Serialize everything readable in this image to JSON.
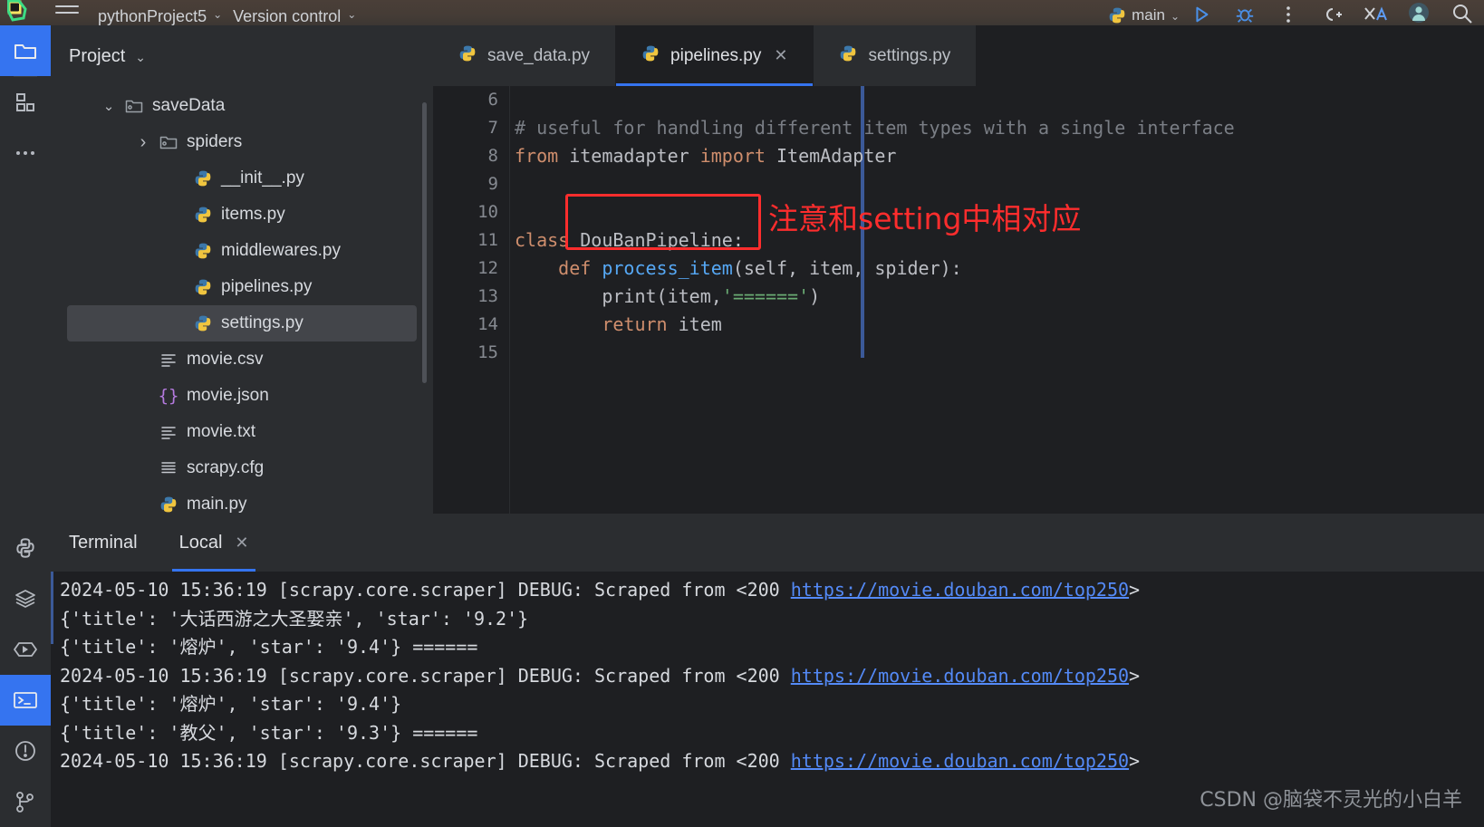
{
  "window": {
    "project_name": "pythonProject5",
    "version_control": "Version control",
    "run_config": "main"
  },
  "rail": {
    "items": [
      {
        "name": "project-folder",
        "icon": "folder-icon",
        "active": true
      },
      {
        "name": "structure",
        "icon": "structure-icon",
        "active": false
      },
      {
        "name": "more-tool-windows",
        "icon": "ellipsis-icon",
        "active": false
      },
      {
        "name": "python-packages",
        "icon": "python-icon",
        "active": false
      },
      {
        "name": "database",
        "icon": "layers-icon",
        "active": false
      },
      {
        "name": "run",
        "icon": "run-icon",
        "active": false
      },
      {
        "name": "terminal",
        "icon": "terminal-icon",
        "active": true
      },
      {
        "name": "problems",
        "icon": "warning-icon",
        "active": false
      },
      {
        "name": "version-control",
        "icon": "branch-icon",
        "active": false
      }
    ]
  },
  "project_panel": {
    "title": "Project",
    "tree": [
      {
        "label": "saveData",
        "icon": "folder-icon",
        "indent": 1,
        "arrow": "down",
        "selected": false
      },
      {
        "label": "spiders",
        "icon": "folder-icon",
        "indent": 2,
        "arrow": "right",
        "selected": false
      },
      {
        "label": "__init__.py",
        "icon": "python-icon",
        "indent": 3,
        "arrow": "none",
        "selected": false
      },
      {
        "label": "items.py",
        "icon": "python-icon",
        "indent": 3,
        "arrow": "none",
        "selected": false
      },
      {
        "label": "middlewares.py",
        "icon": "python-icon",
        "indent": 3,
        "arrow": "none",
        "selected": false
      },
      {
        "label": "pipelines.py",
        "icon": "python-icon",
        "indent": 3,
        "arrow": "none",
        "selected": false
      },
      {
        "label": "settings.py",
        "icon": "python-icon",
        "indent": 3,
        "arrow": "none",
        "selected": true
      },
      {
        "label": "movie.csv",
        "icon": "text-icon",
        "indent": 2,
        "arrow": "none",
        "selected": false
      },
      {
        "label": "movie.json",
        "icon": "json-icon",
        "indent": 2,
        "arrow": "none",
        "selected": false
      },
      {
        "label": "movie.txt",
        "icon": "text-icon",
        "indent": 2,
        "arrow": "none",
        "selected": false
      },
      {
        "label": "scrapy.cfg",
        "icon": "cfg-icon",
        "indent": 2,
        "arrow": "none",
        "selected": false
      },
      {
        "label": "main.py",
        "icon": "python-icon",
        "indent": 2,
        "arrow": "none",
        "selected": false
      }
    ]
  },
  "editor": {
    "tabs": [
      {
        "label": "save_data.py",
        "active": false,
        "closable": false
      },
      {
        "label": "pipelines.py",
        "active": true,
        "closable": true
      },
      {
        "label": "settings.py",
        "active": false,
        "closable": false
      }
    ],
    "first_line_number": 6,
    "lines": [
      {
        "n": "6",
        "tokens": []
      },
      {
        "n": "7",
        "tokens": [
          {
            "t": "# useful for handling different item types with a single interface",
            "c": "comment"
          }
        ]
      },
      {
        "n": "8",
        "tokens": [
          {
            "t": "from",
            "c": "kw"
          },
          {
            "t": " itemadapter ",
            "c": "plain"
          },
          {
            "t": "import",
            "c": "kw"
          },
          {
            "t": " ItemAdapter",
            "c": "plain"
          }
        ]
      },
      {
        "n": "9",
        "tokens": []
      },
      {
        "n": "10",
        "tokens": []
      },
      {
        "n": "11",
        "tokens": [
          {
            "t": "class",
            "c": "kw"
          },
          {
            "t": " DouBanPipeline:",
            "c": "plain"
          }
        ]
      },
      {
        "n": "12",
        "tokens": [
          {
            "t": "    ",
            "c": "plain"
          },
          {
            "t": "def",
            "c": "kw"
          },
          {
            "t": " ",
            "c": "plain"
          },
          {
            "t": "process_item",
            "c": "fn"
          },
          {
            "t": "(self, item, spider):",
            "c": "plain"
          }
        ]
      },
      {
        "n": "13",
        "tokens": [
          {
            "t": "        print(item,",
            "c": "plain"
          },
          {
            "t": "'======'",
            "c": "str"
          },
          {
            "t": ")",
            "c": "plain"
          }
        ]
      },
      {
        "n": "14",
        "tokens": [
          {
            "t": "        ",
            "c": "plain"
          },
          {
            "t": "return",
            "c": "kw"
          },
          {
            "t": " item",
            "c": "plain"
          }
        ]
      },
      {
        "n": "15",
        "tokens": []
      }
    ],
    "annotation": {
      "boxed_text": "DouBanPipeline:",
      "note": "注意和setting中相对应",
      "color": "#ff2d2d"
    }
  },
  "terminal": {
    "title": "Terminal",
    "tabs": [
      {
        "label": "Local",
        "active": true,
        "closable": true
      }
    ],
    "lines": [
      {
        "parts": [
          {
            "t": "2024-05-10 15:36:19 [scrapy.core.scraper] DEBUG: Scraped from <200 ",
            "link": false
          },
          {
            "t": "https://movie.douban.com/top250",
            "link": true
          },
          {
            "t": ">",
            "link": false
          }
        ]
      },
      {
        "parts": [
          {
            "t": "{'title': '大话西游之大圣娶亲', 'star': '9.2'}",
            "link": false
          }
        ]
      },
      {
        "parts": [
          {
            "t": "{'title': '熔炉', 'star': '9.4'} ======",
            "link": false
          }
        ]
      },
      {
        "parts": [
          {
            "t": "2024-05-10 15:36:19 [scrapy.core.scraper] DEBUG: Scraped from <200 ",
            "link": false
          },
          {
            "t": "https://movie.douban.com/top250",
            "link": true
          },
          {
            "t": ">",
            "link": false
          }
        ]
      },
      {
        "parts": [
          {
            "t": "{'title': '熔炉', 'star': '9.4'}",
            "link": false
          }
        ]
      },
      {
        "parts": [
          {
            "t": "{'title': '教父', 'star': '9.3'} ======",
            "link": false
          }
        ]
      },
      {
        "parts": [
          {
            "t": "2024-05-10 15:36:19 [scrapy.core.scraper] DEBUG: Scraped from <200 ",
            "link": false
          },
          {
            "t": "https://movie.douban.com/top250",
            "link": true
          },
          {
            "t": ">",
            "link": false
          }
        ]
      }
    ]
  },
  "watermark": "CSDN @脑袋不灵光的小白羊",
  "colors": {
    "accent": "#3574f0",
    "annotation": "#ff2d2d",
    "link": "#548af7",
    "panel_bg": "#2b2d30",
    "editor_bg": "#1e1f22"
  }
}
